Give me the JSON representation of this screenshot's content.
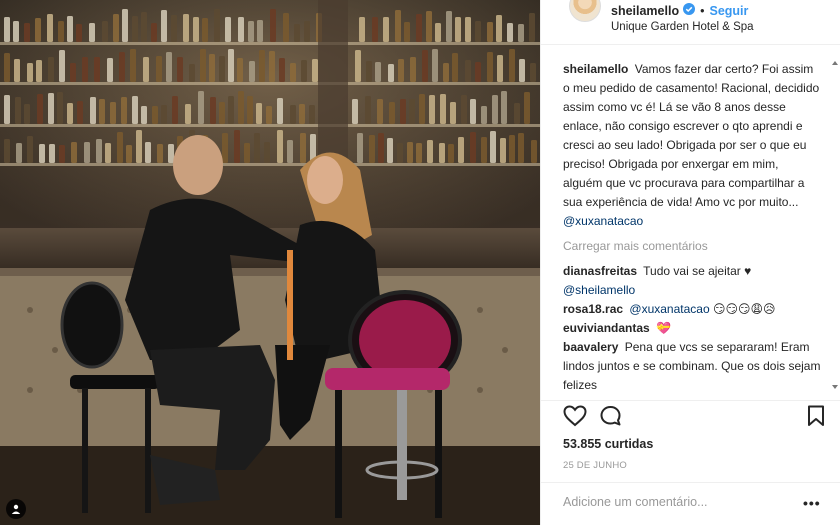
{
  "post": {
    "username": "sheilamello",
    "follow_label": "Seguir",
    "location": "Unique Garden Hotel & Spa"
  },
  "caption": {
    "username": "sheilamello",
    "text": "Vamos fazer dar certo? Foi assim o meu pedido de casamento! Racional, decidido assim como vc é! Lá se vão 8 anos desse enlace, não consigo escrever o qto aprendi e cresci ao seu lado! Obrigada por ser o que eu preciso! Obrigada por enxergar em mim, alguém que vc procurava para compartilhar a sua experiência de vida! Amo vc por muito...",
    "mention": "@xuxanatacao"
  },
  "load_more_label": "Carregar mais comentários",
  "comments": [
    {
      "username": "dianasfreitas",
      "text": "Tudo vai se ajeitar ♥",
      "mention": "@sheilamello"
    },
    {
      "username": "rosa18.rac",
      "mention": "@xuxanatacao",
      "text": "😏😏😏😩😥"
    },
    {
      "username": "euviviandantas",
      "text": "💝"
    },
    {
      "username": "baavalery",
      "text": "Pena que vcs se separaram! Eram lindos juntos e se combinam. Que os dois sejam felizes"
    }
  ],
  "likes_label": "53.855 curtidas",
  "date_label": "25 DE JUNHO",
  "add_comment_placeholder": "Adicione um comentário...",
  "more_options_label": "•••",
  "colors": {
    "link_blue": "#3897f0",
    "mention_navy": "#003569",
    "muted_gray": "#999999",
    "verified_blue": "#3897f0"
  }
}
